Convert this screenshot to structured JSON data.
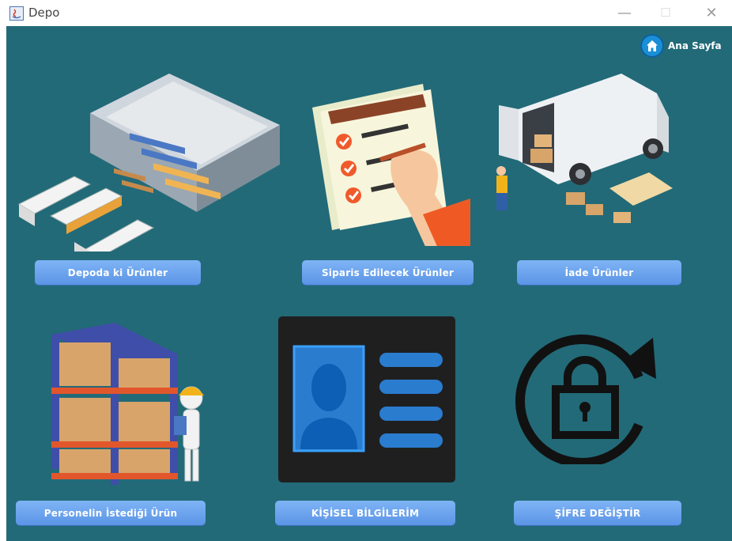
{
  "window": {
    "title": "Depo",
    "minimize": "—",
    "maximize": "☐",
    "close": "✕"
  },
  "header": {
    "home_label": "Ana Sayfa"
  },
  "tiles": [
    {
      "label": "Depoda ki Ürünler",
      "icon": "warehouse-icon"
    },
    {
      "label": "Siparis Edilecek Ürünler",
      "icon": "order-checklist-icon"
    },
    {
      "label": "İade Ürünler",
      "icon": "delivery-van-icon"
    },
    {
      "label": "Personelin İstediği Ürün",
      "icon": "storage-rack-worker-icon"
    },
    {
      "label": "KİŞİSEL BİLGİLERİM",
      "icon": "id-card-icon"
    },
    {
      "label": "ŞİFRE DEĞİŞTİR",
      "icon": "lock-reset-icon"
    }
  ],
  "colors": {
    "background": "#226a78",
    "button": "#6aa2ee",
    "button_text": "#ffffff"
  }
}
